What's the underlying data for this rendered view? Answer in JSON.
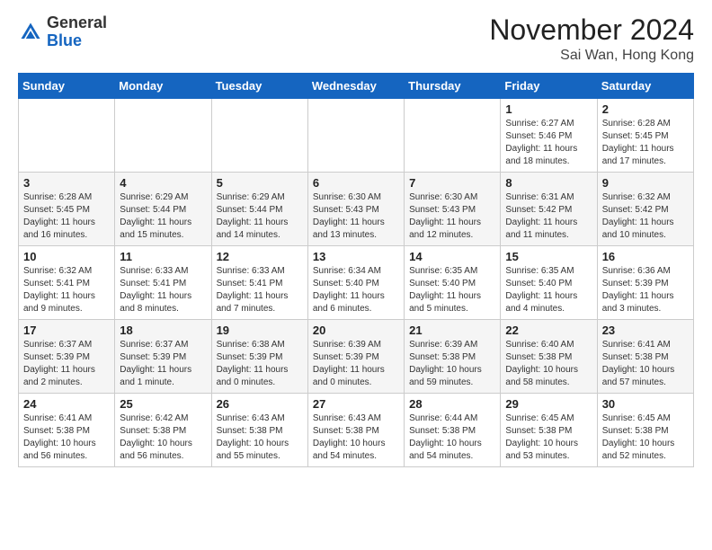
{
  "header": {
    "logo_general": "General",
    "logo_blue": "Blue",
    "month_title": "November 2024",
    "location": "Sai Wan, Hong Kong"
  },
  "weekdays": [
    "Sunday",
    "Monday",
    "Tuesday",
    "Wednesday",
    "Thursday",
    "Friday",
    "Saturday"
  ],
  "weeks": [
    [
      {
        "day": "",
        "info": ""
      },
      {
        "day": "",
        "info": ""
      },
      {
        "day": "",
        "info": ""
      },
      {
        "day": "",
        "info": ""
      },
      {
        "day": "",
        "info": ""
      },
      {
        "day": "1",
        "info": "Sunrise: 6:27 AM\nSunset: 5:46 PM\nDaylight: 11 hours and 18 minutes."
      },
      {
        "day": "2",
        "info": "Sunrise: 6:28 AM\nSunset: 5:45 PM\nDaylight: 11 hours and 17 minutes."
      }
    ],
    [
      {
        "day": "3",
        "info": "Sunrise: 6:28 AM\nSunset: 5:45 PM\nDaylight: 11 hours and 16 minutes."
      },
      {
        "day": "4",
        "info": "Sunrise: 6:29 AM\nSunset: 5:44 PM\nDaylight: 11 hours and 15 minutes."
      },
      {
        "day": "5",
        "info": "Sunrise: 6:29 AM\nSunset: 5:44 PM\nDaylight: 11 hours and 14 minutes."
      },
      {
        "day": "6",
        "info": "Sunrise: 6:30 AM\nSunset: 5:43 PM\nDaylight: 11 hours and 13 minutes."
      },
      {
        "day": "7",
        "info": "Sunrise: 6:30 AM\nSunset: 5:43 PM\nDaylight: 11 hours and 12 minutes."
      },
      {
        "day": "8",
        "info": "Sunrise: 6:31 AM\nSunset: 5:42 PM\nDaylight: 11 hours and 11 minutes."
      },
      {
        "day": "9",
        "info": "Sunrise: 6:32 AM\nSunset: 5:42 PM\nDaylight: 11 hours and 10 minutes."
      }
    ],
    [
      {
        "day": "10",
        "info": "Sunrise: 6:32 AM\nSunset: 5:41 PM\nDaylight: 11 hours and 9 minutes."
      },
      {
        "day": "11",
        "info": "Sunrise: 6:33 AM\nSunset: 5:41 PM\nDaylight: 11 hours and 8 minutes."
      },
      {
        "day": "12",
        "info": "Sunrise: 6:33 AM\nSunset: 5:41 PM\nDaylight: 11 hours and 7 minutes."
      },
      {
        "day": "13",
        "info": "Sunrise: 6:34 AM\nSunset: 5:40 PM\nDaylight: 11 hours and 6 minutes."
      },
      {
        "day": "14",
        "info": "Sunrise: 6:35 AM\nSunset: 5:40 PM\nDaylight: 11 hours and 5 minutes."
      },
      {
        "day": "15",
        "info": "Sunrise: 6:35 AM\nSunset: 5:40 PM\nDaylight: 11 hours and 4 minutes."
      },
      {
        "day": "16",
        "info": "Sunrise: 6:36 AM\nSunset: 5:39 PM\nDaylight: 11 hours and 3 minutes."
      }
    ],
    [
      {
        "day": "17",
        "info": "Sunrise: 6:37 AM\nSunset: 5:39 PM\nDaylight: 11 hours and 2 minutes."
      },
      {
        "day": "18",
        "info": "Sunrise: 6:37 AM\nSunset: 5:39 PM\nDaylight: 11 hours and 1 minute."
      },
      {
        "day": "19",
        "info": "Sunrise: 6:38 AM\nSunset: 5:39 PM\nDaylight: 11 hours and 0 minutes."
      },
      {
        "day": "20",
        "info": "Sunrise: 6:39 AM\nSunset: 5:39 PM\nDaylight: 11 hours and 0 minutes."
      },
      {
        "day": "21",
        "info": "Sunrise: 6:39 AM\nSunset: 5:38 PM\nDaylight: 10 hours and 59 minutes."
      },
      {
        "day": "22",
        "info": "Sunrise: 6:40 AM\nSunset: 5:38 PM\nDaylight: 10 hours and 58 minutes."
      },
      {
        "day": "23",
        "info": "Sunrise: 6:41 AM\nSunset: 5:38 PM\nDaylight: 10 hours and 57 minutes."
      }
    ],
    [
      {
        "day": "24",
        "info": "Sunrise: 6:41 AM\nSunset: 5:38 PM\nDaylight: 10 hours and 56 minutes."
      },
      {
        "day": "25",
        "info": "Sunrise: 6:42 AM\nSunset: 5:38 PM\nDaylight: 10 hours and 56 minutes."
      },
      {
        "day": "26",
        "info": "Sunrise: 6:43 AM\nSunset: 5:38 PM\nDaylight: 10 hours and 55 minutes."
      },
      {
        "day": "27",
        "info": "Sunrise: 6:43 AM\nSunset: 5:38 PM\nDaylight: 10 hours and 54 minutes."
      },
      {
        "day": "28",
        "info": "Sunrise: 6:44 AM\nSunset: 5:38 PM\nDaylight: 10 hours and 54 minutes."
      },
      {
        "day": "29",
        "info": "Sunrise: 6:45 AM\nSunset: 5:38 PM\nDaylight: 10 hours and 53 minutes."
      },
      {
        "day": "30",
        "info": "Sunrise: 6:45 AM\nSunset: 5:38 PM\nDaylight: 10 hours and 52 minutes."
      }
    ]
  ]
}
